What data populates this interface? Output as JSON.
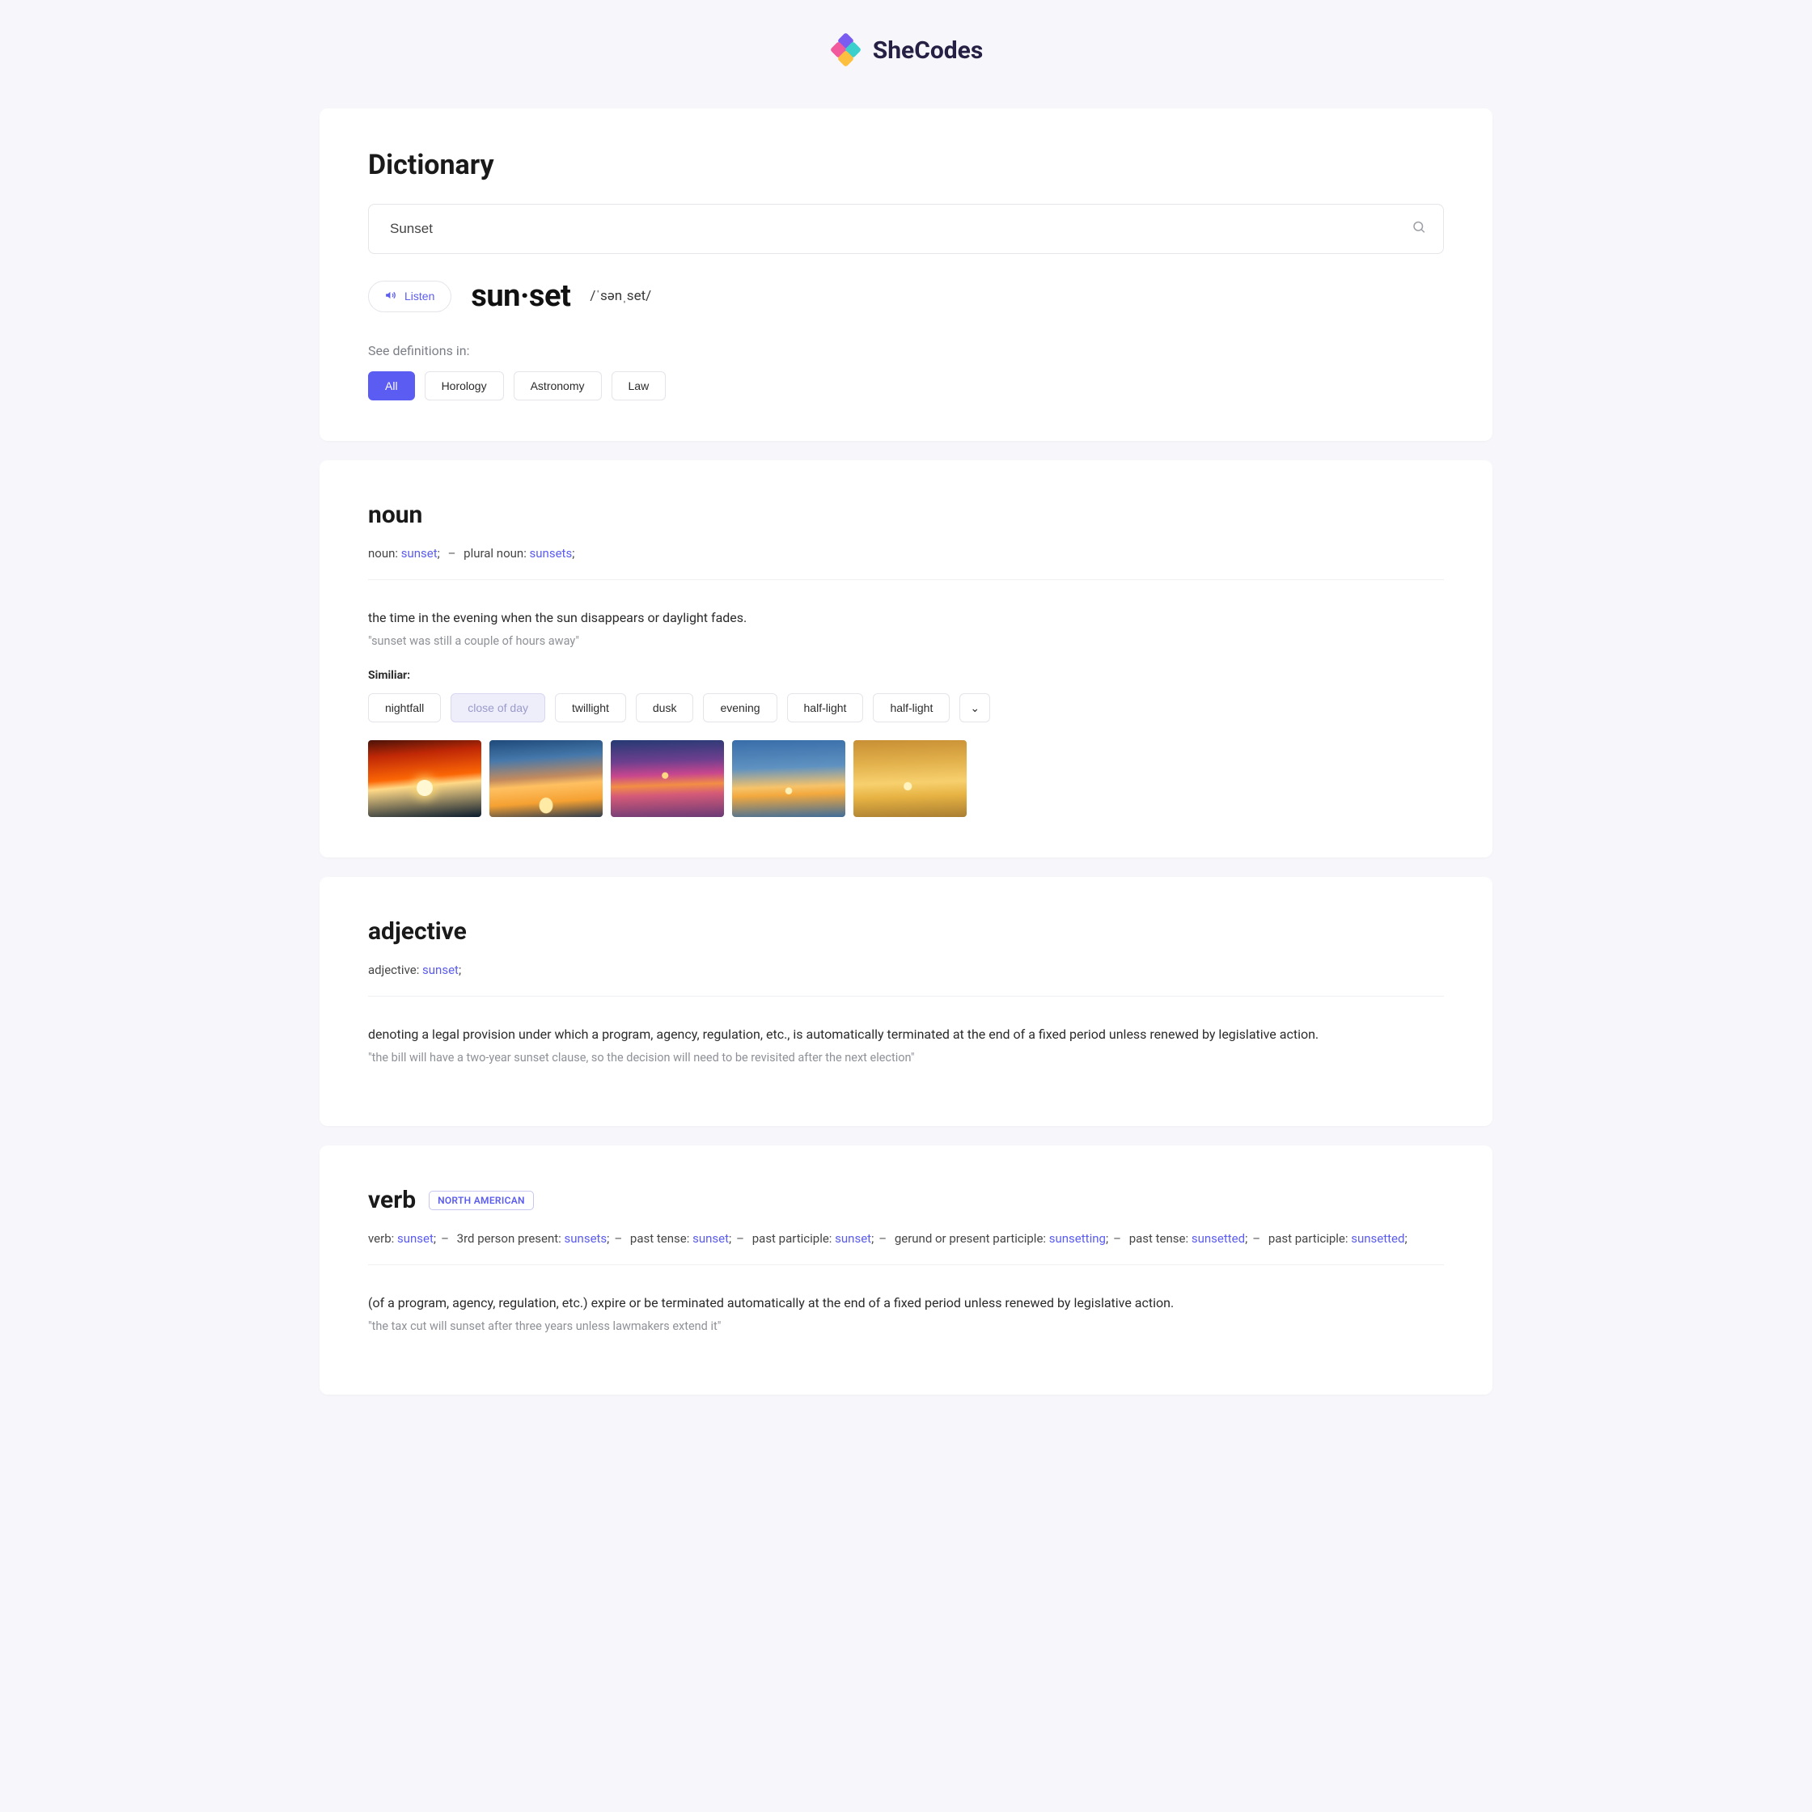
{
  "brand": {
    "name": "SheCodes"
  },
  "header": {
    "title": "Dictionary",
    "search_value": "Sunset"
  },
  "word": {
    "listen_label": "Listen",
    "syllables": "sun·set",
    "phonetic": "/ˈsənˌset/"
  },
  "filters": {
    "label": "See definitions in:",
    "items": [
      "All",
      "Horology",
      "Astronomy",
      "Law"
    ],
    "active_index": 0
  },
  "noun": {
    "heading": "noun",
    "forms_prefix_a": "noun: ",
    "forms_word_a": "sunset",
    "forms_prefix_b": "plural noun: ",
    "forms_word_b": "sunsets",
    "definition": "the time in the evening when the sun disappears or daylight fades.",
    "example": "\"sunset was still a couple of hours away\"",
    "similar_label": "Similiar:",
    "similar": [
      "nightfall",
      "close of day",
      "twillight",
      "dusk",
      "evening",
      "half-light",
      "half-light"
    ]
  },
  "adjective": {
    "heading": "adjective",
    "forms_prefix": "adjective: ",
    "forms_word": "sunset",
    "definition": "denoting a legal provision under which a program, agency, regulation, etc., is automatically terminated at the end of a fixed period unless renewed by legislative action.",
    "example": "\"the bill will have a two-year sunset clause, so the decision will need to be revisited after the next election\""
  },
  "verb": {
    "heading": "verb",
    "region": "NORTH AMERICAN",
    "forms": [
      {
        "label": "verb: ",
        "word": "sunset"
      },
      {
        "label": "3rd person present: ",
        "word": "sunsets"
      },
      {
        "label": "past tense: ",
        "word": "sunset"
      },
      {
        "label": "past participle: ",
        "word": "sunset"
      },
      {
        "label": "gerund or present participle: ",
        "word": "sunsetting"
      },
      {
        "label": "past tense: ",
        "word": "sunsetted"
      },
      {
        "label": "past participle: ",
        "word": "sunsetted"
      }
    ],
    "definition": "(of a program, agency, regulation, etc.) expire or be terminated automatically at the end of a fixed period unless renewed by legislative action.",
    "example": "\"the tax cut will sunset after three years unless lawmakers extend it\""
  },
  "expand_glyph": "⌄"
}
